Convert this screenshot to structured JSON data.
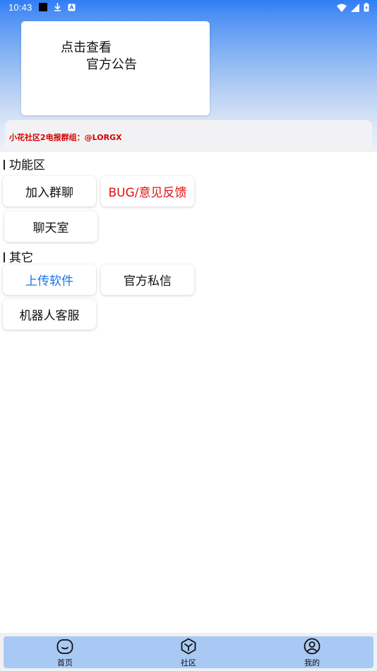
{
  "status_bar": {
    "time": "10:43"
  },
  "notice": {
    "line1": "点击查看",
    "line2": "官方公告"
  },
  "group_info": {
    "text": "小花社区2电报群组：@LORGX"
  },
  "sections": {
    "features": {
      "title": "功能区",
      "buttons": [
        "加入群聊",
        "BUG/意见反馈",
        "聊天室"
      ]
    },
    "other": {
      "title": "其它",
      "buttons": [
        "上传软件",
        "官方私信",
        "机器人客服"
      ]
    }
  },
  "bottom_nav": {
    "items": [
      {
        "label": "首页",
        "icon": "home-face-icon"
      },
      {
        "label": "社区",
        "icon": "community-cube-icon"
      },
      {
        "label": "我的",
        "icon": "profile-icon"
      }
    ]
  },
  "colors": {
    "accent_blue": "#1a73e8",
    "accent_red": "#e01010",
    "nav_bar": "#a9c9f5",
    "hero_top": "#2f7df6"
  }
}
